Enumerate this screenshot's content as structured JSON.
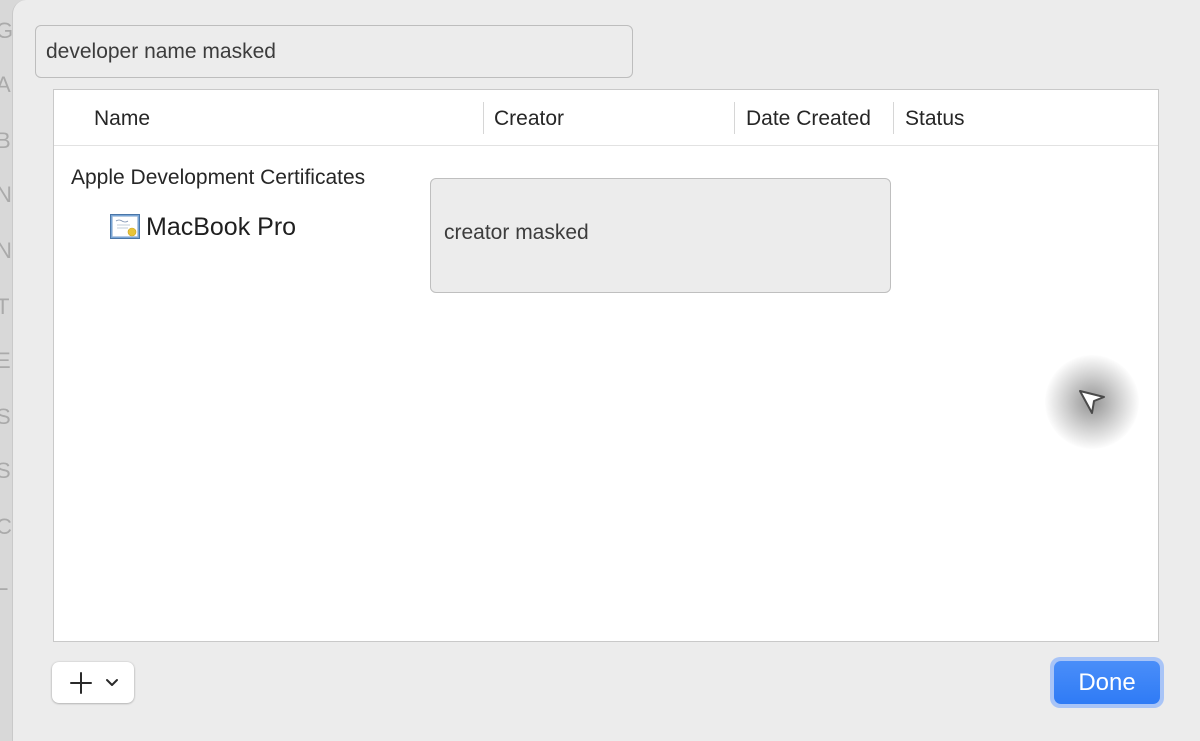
{
  "background_letters": [
    "G",
    "A",
    "B",
    "N",
    "N",
    "T",
    "E",
    "S",
    "S",
    "C",
    "L"
  ],
  "search_field": {
    "value": "developer name masked"
  },
  "table": {
    "columns": [
      "Name",
      "Creator",
      "Date Created",
      "Status"
    ],
    "group_label": "Apple Development Certificates",
    "rows": [
      {
        "name": "MacBook Pro",
        "icon": "certificate-icon",
        "creator": "creator masked"
      }
    ]
  },
  "toolbar": {
    "add_button_icon": "plus-icon",
    "add_menu_icon": "chevron-down-icon",
    "done_label": "Done"
  },
  "colors": {
    "sheet_background": "#ececec",
    "accent": "#2f7bf5",
    "table_background": "#ffffff"
  }
}
